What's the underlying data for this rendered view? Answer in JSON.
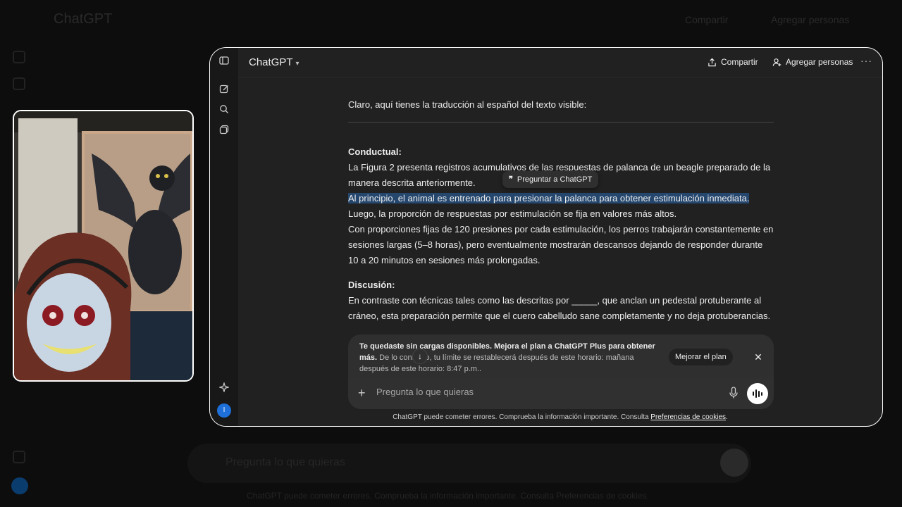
{
  "background_app": {
    "title": "ChatGPT",
    "share_label": "Compartir",
    "add_people_label": "Agregar personas",
    "prompt_placeholder": "Pregunta lo que quieras",
    "footer": "ChatGPT puede cometer errores. Comprueba la información importante. Consulta Preferencias de cookies."
  },
  "header": {
    "model_label": "ChatGPT",
    "share_label": "Compartir",
    "add_people_label": "Agregar personas",
    "more_label": "···"
  },
  "chat": {
    "intro": "Claro, aquí tienes la traducción al español del texto visible:",
    "section1_heading": "Conductual:",
    "section1_line1": "La Figura 2 presenta registros acumulativos de las respuestas de palanca de un beagle preparado de la manera descrita anteriormente.",
    "section1_selected": "Al principio, el animal es entrenado para presionar la palanca para obtener estimulación inmediata.",
    "section1_line3": "Luego, la proporción de respuestas por estimulación se fija en valores más altos.",
    "section1_line4": "Con proporciones fijas de 120 presiones por cada estimulación, los perros trabajarán constantemente en sesiones largas (5–8 horas), pero eventualmente mostrarán descansos dejando de responder durante 10 a 20 minutos en sesiones más prolongadas.",
    "section2_heading": "Discusión:",
    "section2_text": "En contraste con técnicas tales como las descritas por _____, que anclan un pedestal protuberante al cráneo, esta preparación permite que el cuero cabelludo sane completamente y no deja protuberancias."
  },
  "ask_popup": {
    "quote_icon": "❞",
    "label": "Preguntar a ChatGPT"
  },
  "limit_banner": {
    "bold": "Te quedaste sin cargas disponibles. Mejora el plan a ChatGPT Plus para obtener más.",
    "rest": " De lo contrario, tu límite se restablecerá después de este horario: mañana después de este horario: 8:47 p.m..",
    "upgrade_label": "Mejorar el plan",
    "close_label": "✕"
  },
  "composer": {
    "plus_label": "+",
    "placeholder": "Pregunta lo que quieras"
  },
  "footer": {
    "text": "ChatGPT puede cometer errores. Comprueba la información importante. Consulta ",
    "link": "Preferencias de cookies",
    "end": "."
  },
  "user": {
    "avatar_initial": "I"
  },
  "icons": {
    "sidebar_toggle": "sidebar-toggle-icon",
    "new_chat": "new-chat-icon",
    "search": "search-icon",
    "library": "library-icon",
    "sparkle": "sparkle-icon",
    "share": "share-icon",
    "add_person": "add-person-icon",
    "mic": "mic-icon",
    "voice": "voice-mode-icon",
    "arrow_down": "arrow-down-icon"
  },
  "colors": {
    "window_bg": "#212121",
    "selection": "#25476e",
    "accent_avatar": "#1e6fd9"
  }
}
